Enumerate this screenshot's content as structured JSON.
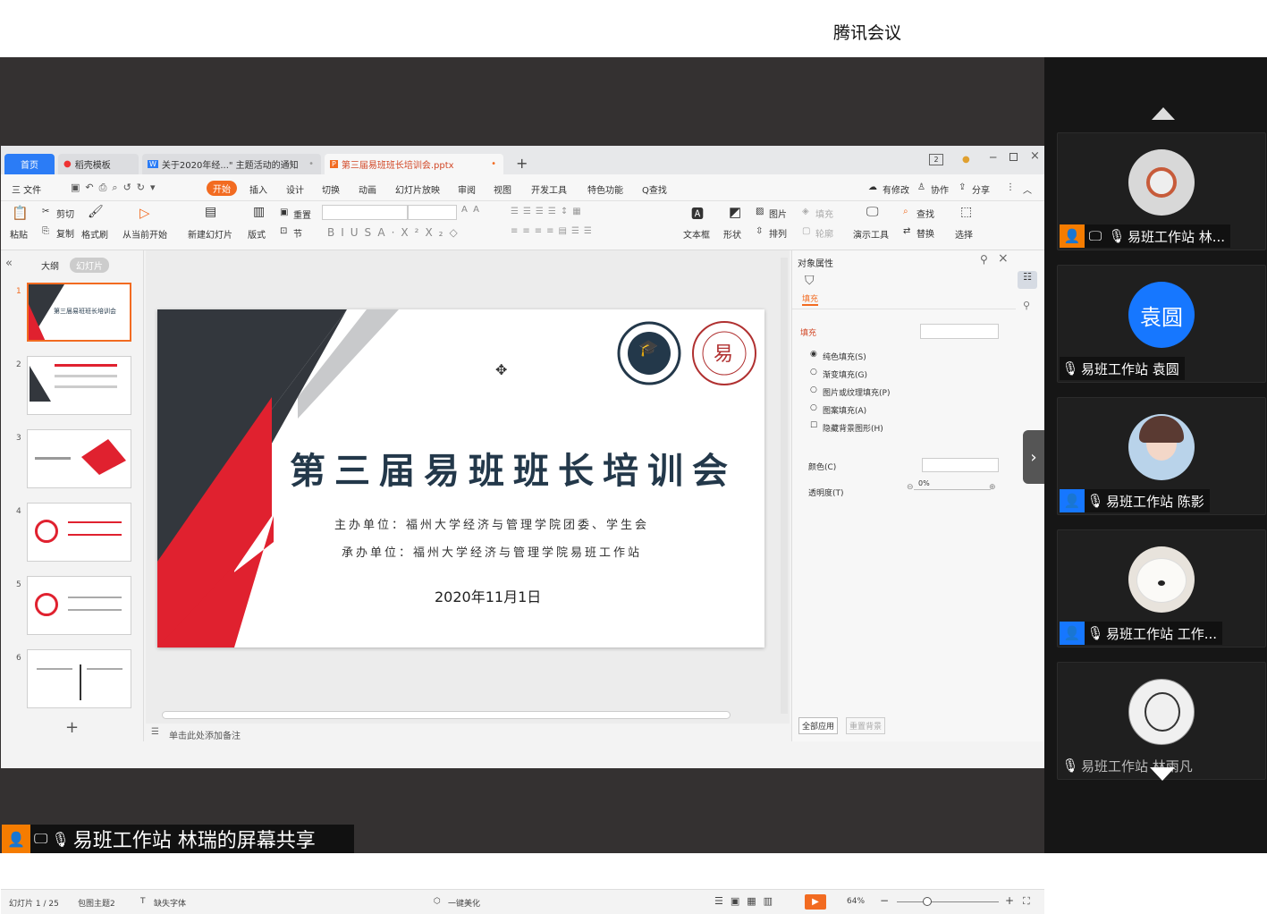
{
  "meeting": {
    "title": "腾讯会议",
    "share_label": "易班工作站 林瑞的屏幕共享"
  },
  "participants": [
    {
      "name": "易班工作站 林...",
      "avatar": "logo"
    },
    {
      "name": "易班工作站 袁圆",
      "avatar_text": "袁圆"
    },
    {
      "name": "易班工作站 陈影",
      "avatar": "anime"
    },
    {
      "name": "易班工作站 工作...",
      "avatar": "dog"
    },
    {
      "name": "易班工作站 林雨凡",
      "avatar": "sketch"
    }
  ],
  "wps": {
    "tabs": {
      "home": "首页",
      "t1": "稻壳模板",
      "t2": "关于2020年经...\" 主题活动的通知",
      "t3": "第三届易班班长培训会.pptx"
    },
    "menu": {
      "file": "三 文件",
      "start": "开始",
      "insert": "插入",
      "design": "设计",
      "switch": "切换",
      "anim": "动画",
      "show": "幻灯片放映",
      "review": "审阅",
      "view": "视图",
      "dev": "开发工具",
      "special": "特色功能",
      "find": "Q查找",
      "changes": "有修改",
      "collab": "协作",
      "share": "分享"
    },
    "ribbon": {
      "paste": "粘贴",
      "cut": "剪切",
      "copy": "复制",
      "format": "格式刷",
      "from_current": "从当前开始",
      "new_slide": "新建幻灯片",
      "layout": "版式",
      "reset": "重置",
      "section": "节",
      "textbox": "文本框",
      "shape": "形状",
      "picture": "图片",
      "arrange": "排列",
      "fill": "填充",
      "outline": "轮廓",
      "present": "演示工具",
      "find": "查找",
      "replace": "替换",
      "select": "选择"
    },
    "left": {
      "outline_tab": "大纲",
      "slides_tab": "幻灯片"
    },
    "thumbs": [
      "1",
      "2",
      "3",
      "4",
      "5",
      "6"
    ],
    "slide": {
      "title": "第三届易班班长培训会",
      "host": "主办单位：福州大学经济与管理学院团委、学生会",
      "organizer": "承办单位：福州大学经济与管理学院易班工作站",
      "date": "2020年11月1日",
      "seal_center": "易"
    },
    "props": {
      "header": "对象属性",
      "fill_tab": "填充",
      "section": "填充",
      "solid": "纯色填充(S)",
      "gradient": "渐变填充(G)",
      "picture": "图片或纹理填充(P)",
      "pattern": "图案填充(A)",
      "hide_bg": "隐藏背景图形(H)",
      "color": "颜色(C)",
      "transparency": "透明度(T)",
      "transparency_val": "0%",
      "apply_all": "全部应用",
      "reset_bg": "重置背景"
    },
    "notes": "单击此处添加备注",
    "status": {
      "slide_count": "幻灯片 1 / 25",
      "theme": "包图主题2",
      "missing_font": "缺失字体",
      "beautify": "一键美化",
      "zoom": "64%"
    }
  },
  "colors": {
    "accent": "#d9342b",
    "wps_orange": "#f26b21",
    "blue": "#1677ff",
    "slide_red": "#e0212f",
    "slide_dark": "#33373d",
    "title_text": "#23384a"
  }
}
